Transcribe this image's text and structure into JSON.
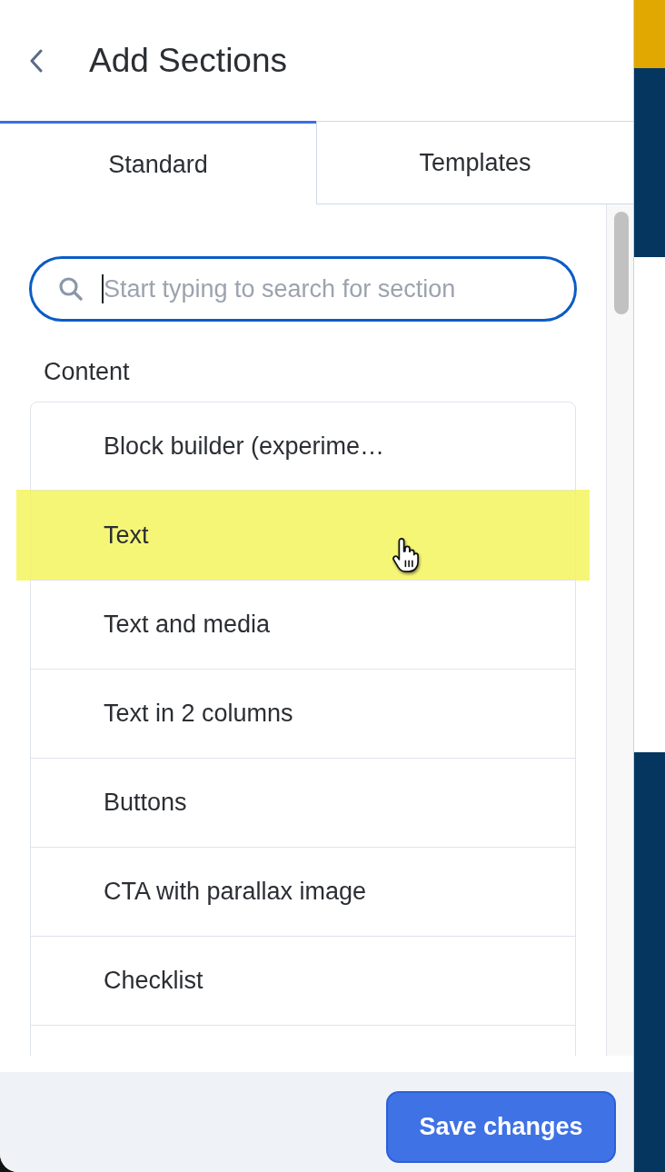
{
  "header": {
    "title": "Add Sections"
  },
  "tabs": [
    {
      "label": "Standard",
      "selected": true
    },
    {
      "label": "Templates",
      "selected": false
    }
  ],
  "search": {
    "placeholder": "Start typing to search for section",
    "focused": true
  },
  "sections": {
    "heading": "Content",
    "items": [
      {
        "label": "Block builder (experime…",
        "highlighted": false,
        "hovered": false
      },
      {
        "label": "Text",
        "highlighted": true,
        "hovered": true
      },
      {
        "label": "Text and media",
        "highlighted": false,
        "hovered": false
      },
      {
        "label": "Text in 2 columns",
        "highlighted": false,
        "hovered": false
      },
      {
        "label": "Buttons",
        "highlighted": false,
        "hovered": false
      },
      {
        "label": "CTA with parallax image",
        "highlighted": false,
        "hovered": false
      },
      {
        "label": "Checklist",
        "highlighted": false,
        "hovered": false
      }
    ]
  },
  "footer": {
    "save_button": "Save changes"
  }
}
